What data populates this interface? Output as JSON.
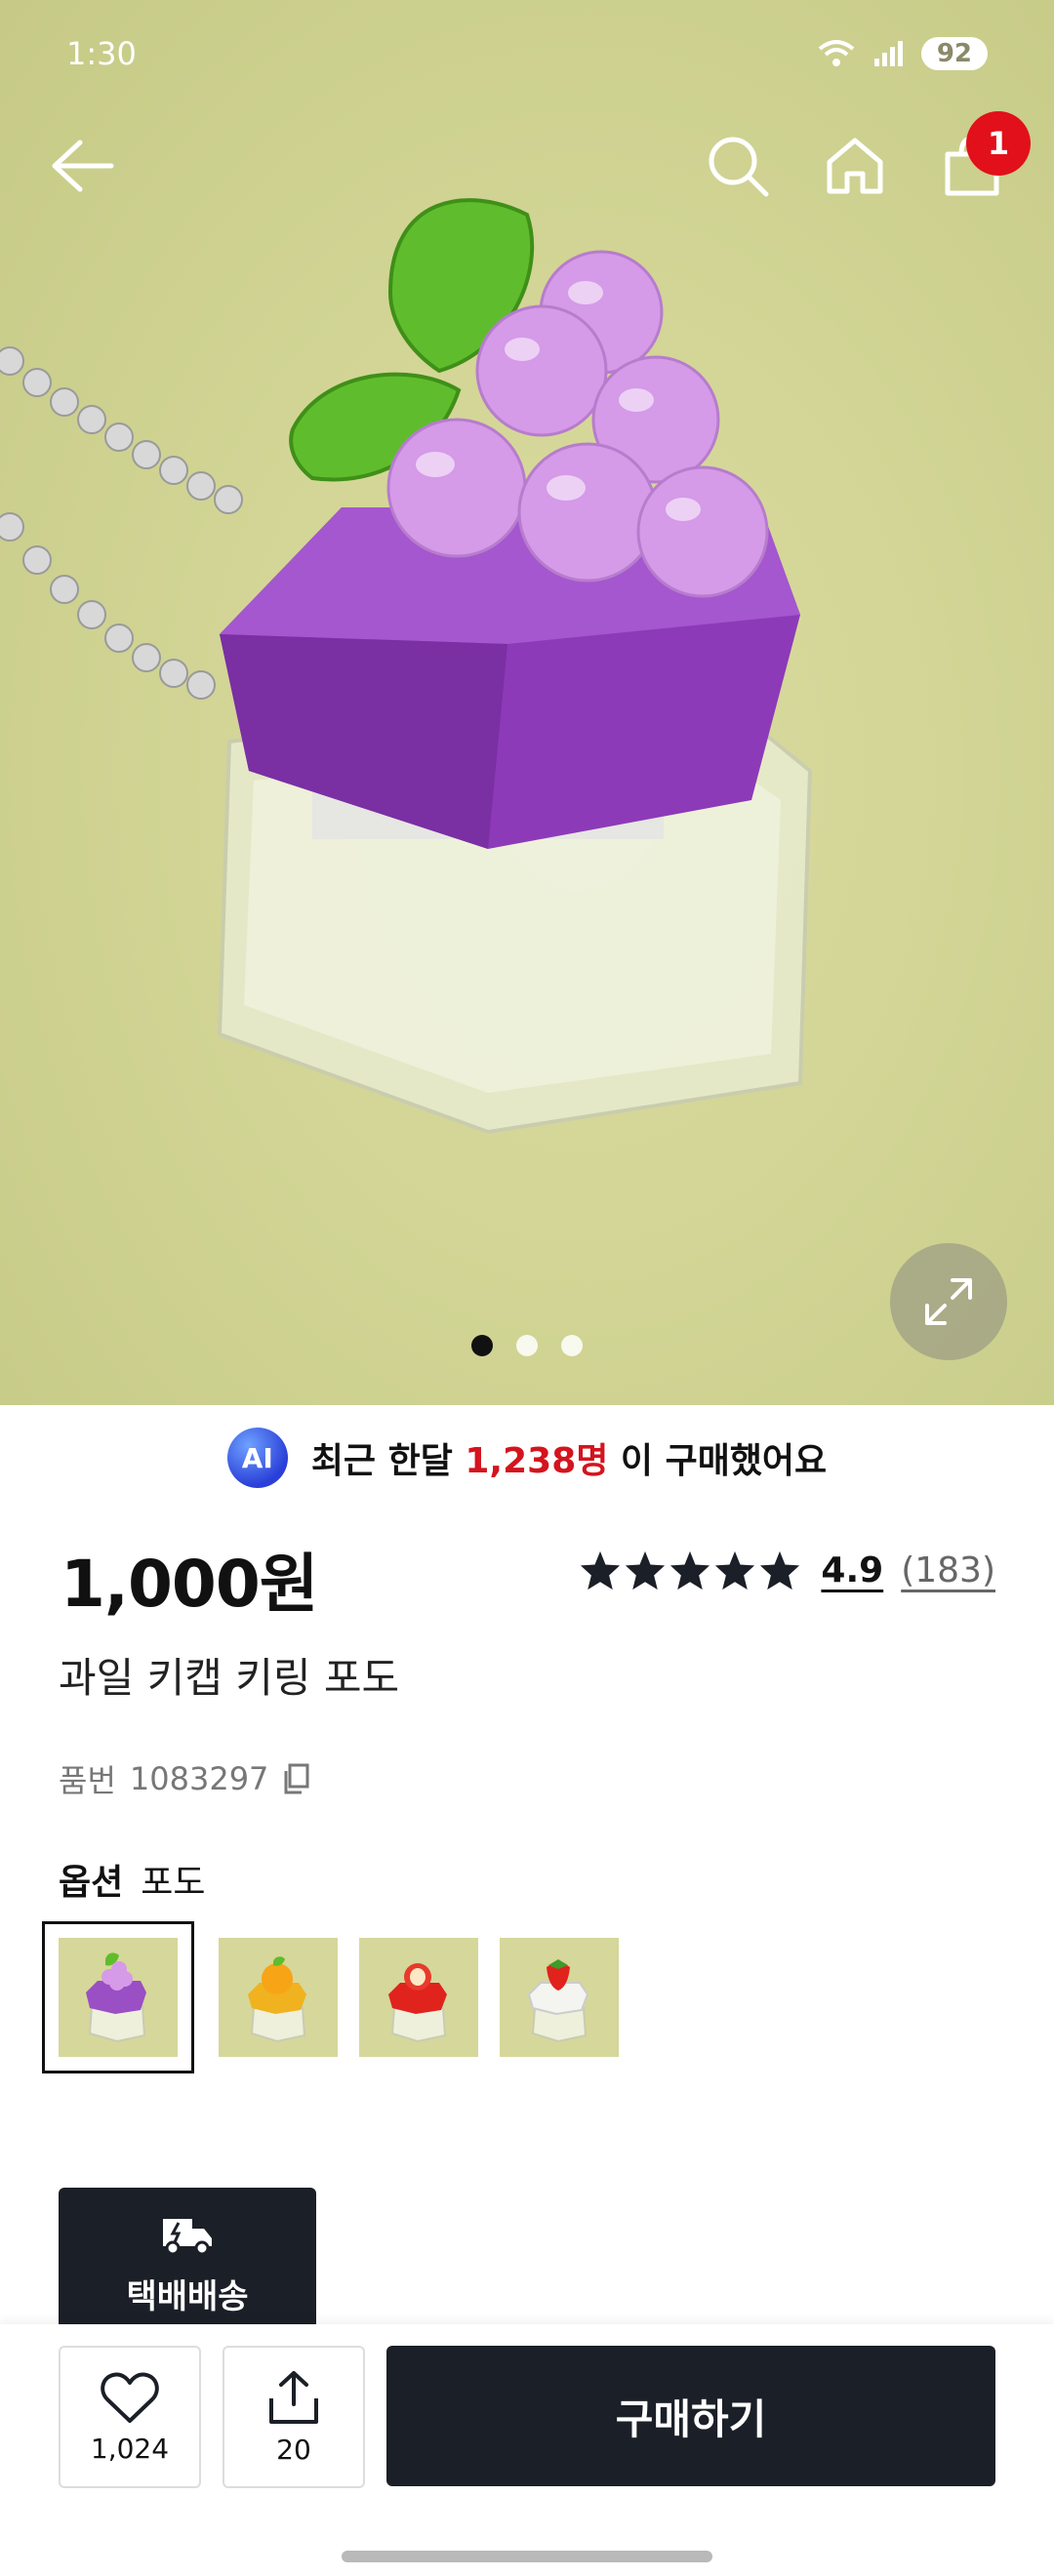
{
  "status_bar": {
    "time": "1:30",
    "battery": "92"
  },
  "header": {
    "cart_count": "1"
  },
  "gallery": {
    "page_count": 3,
    "active_index": 0
  },
  "ai_banner": {
    "badge": "AI",
    "prefix": "최근 한달",
    "count": "1,238명",
    "suffix": "이 구매했어요"
  },
  "product": {
    "price": "1,000원",
    "rating": "4.9",
    "review_count": "(183)",
    "stars": 5,
    "title": "과일 키캡 키링 포도",
    "sku_label": "품번",
    "sku": "1083297"
  },
  "options": {
    "label": "옵션",
    "selected": "포도",
    "items": [
      {
        "name": "grape",
        "color": "#9a4fc4"
      },
      {
        "name": "orange",
        "color": "#f0b21e"
      },
      {
        "name": "apple",
        "color": "#e0231d"
      },
      {
        "name": "strawberry",
        "color": "#f4f4f0"
      }
    ]
  },
  "delivery": {
    "label": "택배배송"
  },
  "bottom_bar": {
    "like_count": "1,024",
    "share_count": "20",
    "buy_label": "구매하기"
  },
  "colors": {
    "accent_red": "#d4141e",
    "dark": "#1b1f27"
  }
}
